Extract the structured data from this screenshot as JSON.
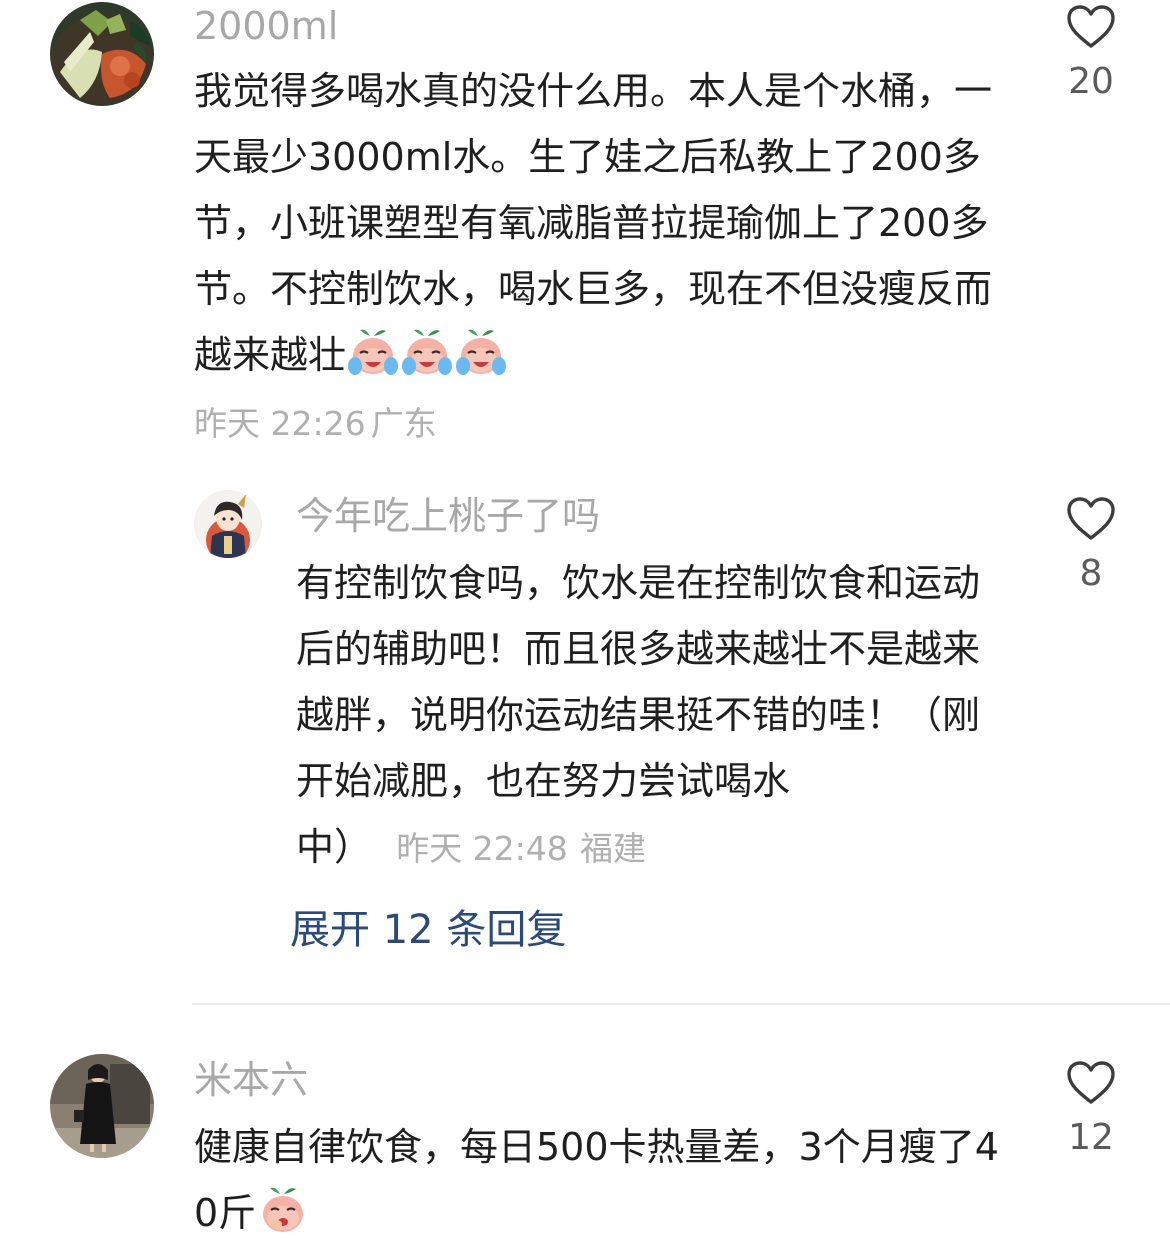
{
  "comments": [
    {
      "username": "2000ml",
      "text": "我觉得多喝水真的没什么用。本人是个水桶，一天最少3000ml水。生了娃之后私教上了200多节，小班课塑型有氧减脂普拉提瑜伽上了200多节。不控制饮水，喝水巨多，现在不但没瘦反而越来越壮",
      "emojis": [
        "crying-peach-emoji",
        "crying-peach-emoji",
        "crying-peach-emoji"
      ],
      "time": "昨天 22:26",
      "location": "广东",
      "likes": "20",
      "icon": "heart-outline-icon"
    },
    {
      "username": "今年吃上桃子了吗",
      "text": "有控制饮食吗，饮水是在控制饮食和运动后的辅助吧！而且很多越来越壮不是越来越胖，说明你运动结果挺不错的哇！（刚开始减肥，也在努力尝试喝水中）",
      "time": "昨天 22:48",
      "location": "福建",
      "likes": "8",
      "expand_label": "展开 12 条回复",
      "icon": "heart-outline-icon"
    },
    {
      "username": "米本六",
      "text": "健康自律饮食，每日500卡热量差，3个月瘦了40斤",
      "emojis": [
        "giggling-peach-emoji"
      ],
      "likes": "12",
      "icon": "heart-outline-icon"
    }
  ],
  "colors": {
    "username": "#a8a8a8",
    "body_text": "#1f1f1f",
    "meta": "#b0b0b0",
    "like_count": "#5b5b5b",
    "expand_link": "#2a4a78",
    "divider": "#ececec"
  }
}
